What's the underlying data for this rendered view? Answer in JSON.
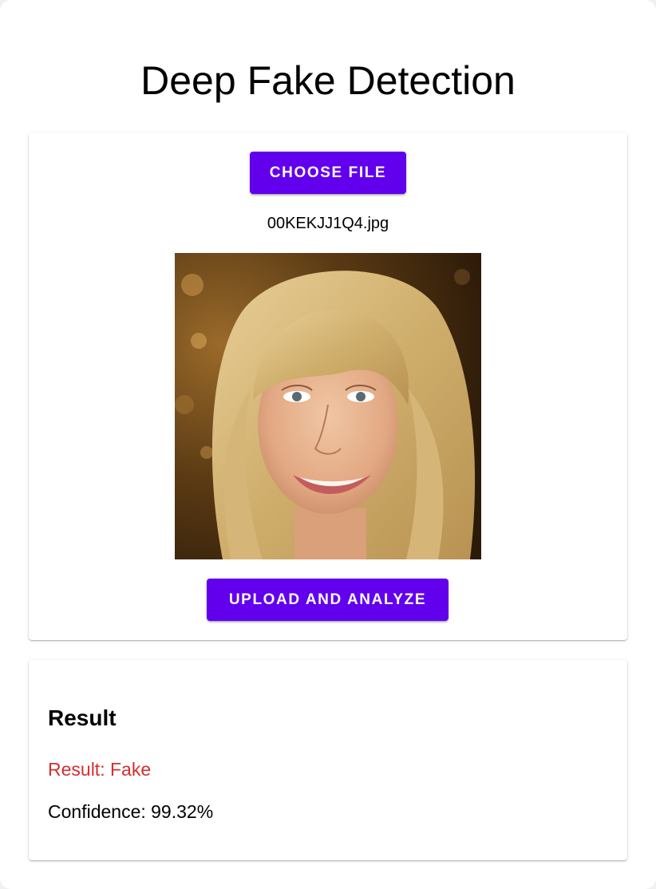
{
  "page": {
    "title": "Deep Fake Detection"
  },
  "upload": {
    "choose_label": "Choose File",
    "filename": "00KEKJJ1Q4.jpg",
    "preview_alt": "00KEKJJ1Q4.jpg",
    "analyze_label": "Upload and Analyze"
  },
  "result": {
    "heading": "Result",
    "label_text": "Result: Fake",
    "confidence_text": "Confidence: 99.32%"
  },
  "colors": {
    "accent": "#6200ee",
    "fake_result": "#d32f2f",
    "text": "#000000",
    "card_background": "#ffffff"
  }
}
